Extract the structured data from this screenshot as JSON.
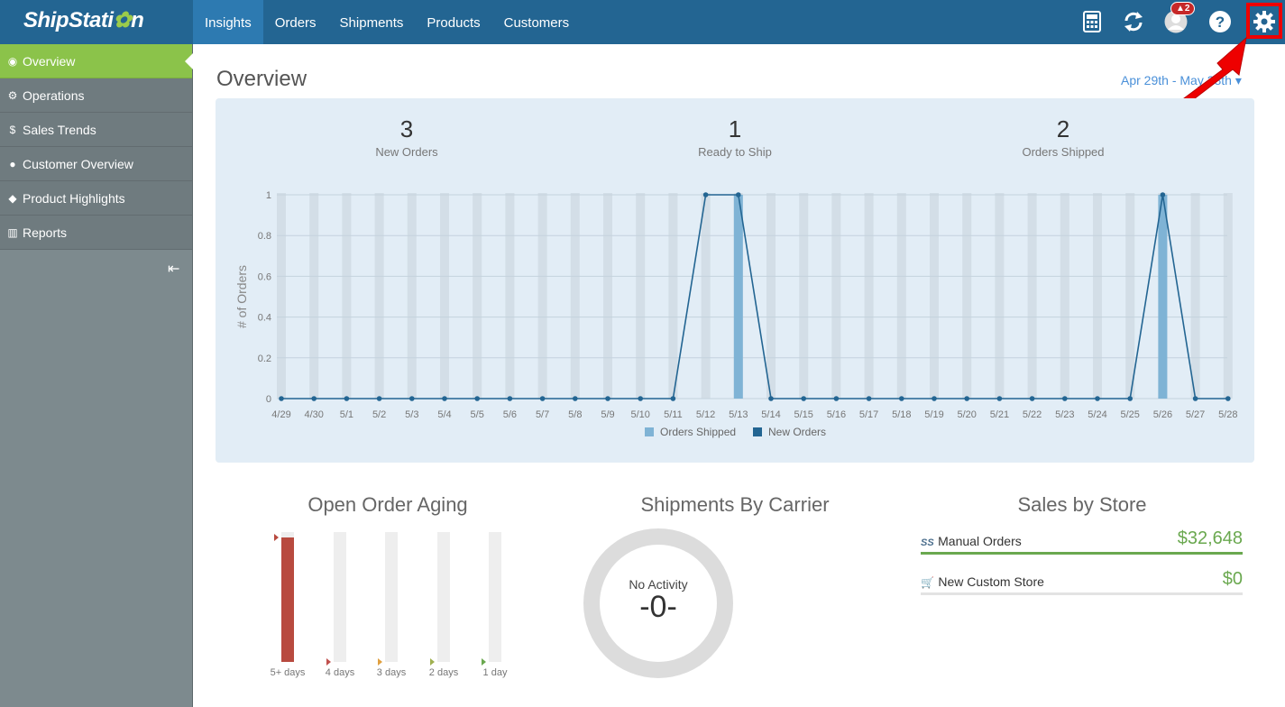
{
  "app": {
    "logo_text": "ShipStati",
    "logo_tail": "n"
  },
  "nav": {
    "items": [
      "Insights",
      "Orders",
      "Shipments",
      "Products",
      "Customers"
    ],
    "active": "Insights"
  },
  "toolbar": {
    "alert_badge": "2",
    "icons": [
      "calculator-icon",
      "refresh-icon",
      "user-icon",
      "help-icon",
      "gear-icon"
    ]
  },
  "sidebar": {
    "items": [
      {
        "label": "Overview",
        "icon": "eye-icon"
      },
      {
        "label": "Operations",
        "icon": "gears-icon"
      },
      {
        "label": "Sales Trends",
        "icon": "dollar-icon"
      },
      {
        "label": "Customer Overview",
        "icon": "users-icon"
      },
      {
        "label": "Product Highlights",
        "icon": "tags-icon"
      },
      {
        "label": "Reports",
        "icon": "bar-chart-icon"
      }
    ]
  },
  "main": {
    "title": "Overview",
    "date_range": "Apr 29th - May 28th"
  },
  "stats": [
    {
      "value": "3",
      "label": "New Orders"
    },
    {
      "value": "1",
      "label": "Ready to Ship"
    },
    {
      "value": "2",
      "label": "Orders Shipped"
    }
  ],
  "chart_data": {
    "type": "line",
    "ylabel": "# of Orders",
    "ylim": [
      0,
      1
    ],
    "yticks": [
      "0",
      "0.2",
      "0.4",
      "0.6",
      "0.8",
      "1"
    ],
    "categories": [
      "4/29",
      "4/30",
      "5/1",
      "5/2",
      "5/3",
      "5/4",
      "5/5",
      "5/6",
      "5/7",
      "5/8",
      "5/9",
      "5/10",
      "5/11",
      "5/12",
      "5/13",
      "5/14",
      "5/15",
      "5/16",
      "5/17",
      "5/18",
      "5/19",
      "5/20",
      "5/21",
      "5/22",
      "5/23",
      "5/24",
      "5/25",
      "5/26",
      "5/27",
      "5/28"
    ],
    "series": [
      {
        "name": "Orders Shipped",
        "kind": "bar",
        "color": "#7fb3d5",
        "values": [
          0,
          0,
          0,
          0,
          0,
          0,
          0,
          0,
          0,
          0,
          0,
          0,
          0,
          0,
          1,
          0,
          0,
          0,
          0,
          0,
          0,
          0,
          0,
          0,
          0,
          0,
          0,
          1,
          0,
          0
        ]
      },
      {
        "name": "New Orders",
        "kind": "line",
        "color": "#236592",
        "values": [
          0,
          0,
          0,
          0,
          0,
          0,
          0,
          0,
          0,
          0,
          0,
          0,
          0,
          1,
          1,
          0,
          0,
          0,
          0,
          0,
          0,
          0,
          0,
          0,
          0,
          0,
          0,
          1,
          0,
          0
        ]
      }
    ],
    "legend": "bottom"
  },
  "aging": {
    "title": "Open Order Aging",
    "buckets": [
      {
        "label": "5+ days",
        "fraction": 0.96,
        "color": "#b84a3f"
      },
      {
        "label": "4 days",
        "fraction": 0,
        "color": "#c0504d"
      },
      {
        "label": "3 days",
        "fraction": 0,
        "color": "#e0a040"
      },
      {
        "label": "2 days",
        "fraction": 0,
        "color": "#a0b050"
      },
      {
        "label": "1 day",
        "fraction": 0,
        "color": "#6aa84f"
      }
    ]
  },
  "carrier": {
    "title": "Shipments By Carrier",
    "caption": "No Activity",
    "value": "-0-"
  },
  "stores": {
    "title": "Sales by Store",
    "items": [
      {
        "name": "Manual Orders",
        "value": "$32,648",
        "icon": "ss-icon",
        "fraction": 1
      },
      {
        "name": "New Custom Store",
        "value": "$0",
        "icon": "cart-icon",
        "fraction": 0
      }
    ]
  },
  "colors": {
    "topbar": "#236592",
    "active_nav": "#2d7ab1",
    "sidebar_active": "#8bc34a",
    "sidebar": "#7d8a8e",
    "panel": "#e2edf6",
    "green_value": "#6aa84f"
  }
}
